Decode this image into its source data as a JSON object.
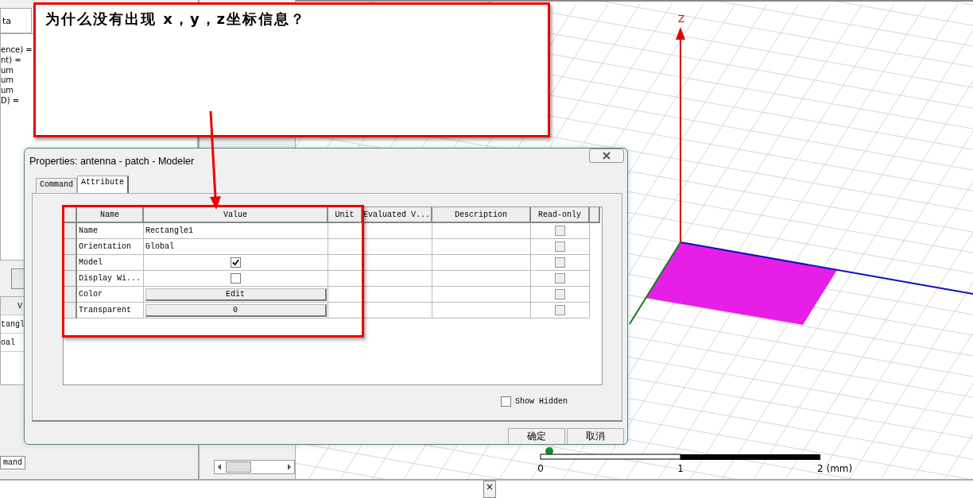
{
  "annotation": {
    "text": "为什么没有出现 x，y，z坐标信息？"
  },
  "left_panel": {
    "tab": "ta",
    "lines": [
      "ence) =",
      "nt) =",
      "um",
      "um",
      "um",
      "D) ="
    ],
    "grid_header": "V",
    "grid_rows": [
      "tangl",
      "oal"
    ],
    "bottom_tab": "mand"
  },
  "dialog": {
    "title": "Properties: antenna - patch - Modeler",
    "tabs": [
      {
        "label": "Command",
        "selected": false
      },
      {
        "label": "Attribute",
        "selected": true
      }
    ],
    "columns": [
      "Name",
      "Value",
      "Unit",
      "Evaluated V...",
      "Description",
      "Read-only"
    ],
    "rows": [
      {
        "name": "Name",
        "kind": "text",
        "value": "Rectangle1",
        "read_only": false
      },
      {
        "name": "Orientation",
        "kind": "text",
        "value": "Global",
        "read_only": false
      },
      {
        "name": "Model",
        "kind": "checkbox",
        "checked": true,
        "read_only": false
      },
      {
        "name": "Display Wi...",
        "kind": "checkbox",
        "checked": false,
        "read_only": false
      },
      {
        "name": "Color",
        "kind": "button",
        "value": "Edit",
        "read_only": false
      },
      {
        "name": "Transparent",
        "kind": "button",
        "value": "0",
        "read_only": false
      }
    ],
    "show_hidden": {
      "label": "Show Hidden",
      "checked": false
    },
    "buttons": [
      "确定",
      "取消"
    ]
  },
  "viewport": {
    "axis_label": "Z",
    "scale_labels": [
      "0",
      "1",
      "2 (mm)"
    ]
  },
  "bottom_panel": {
    "close": "×"
  }
}
